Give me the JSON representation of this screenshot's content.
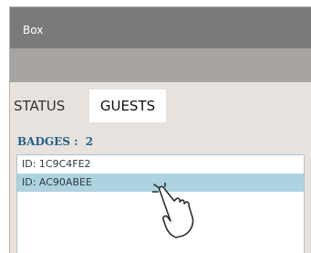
{
  "window": {
    "title": "Box"
  },
  "tabs": [
    {
      "label": "STATUS",
      "active": false
    },
    {
      "label": "GUESTS",
      "active": true
    }
  ],
  "badges": {
    "label": "BADGES :",
    "count": "2"
  },
  "list": {
    "items": [
      {
        "label": "ID: 1C9C4FE2",
        "selected": false
      },
      {
        "label": "ID: AC90ABEE",
        "selected": true
      }
    ]
  },
  "colors": {
    "titlebar": "#7c7a79",
    "subbar": "#a7a4a2",
    "panel": "#e7e2de",
    "accent": "#1f5f88",
    "selected_row": "#aed3e0"
  },
  "icons": {
    "pointer": "hand-tap-icon"
  }
}
